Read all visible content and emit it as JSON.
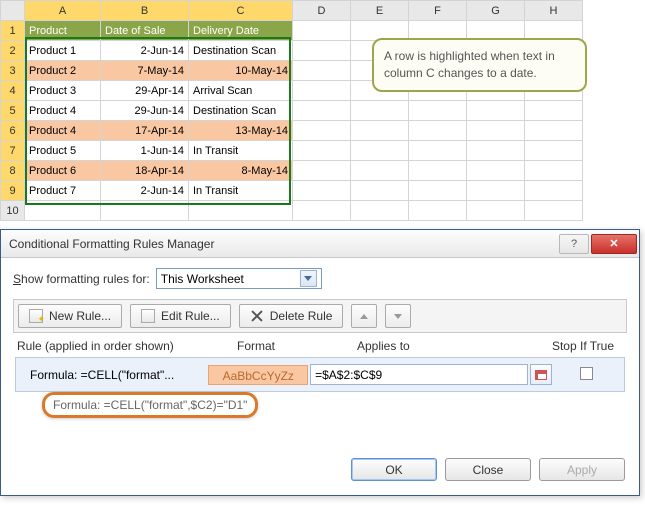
{
  "sheet": {
    "columns": [
      "A",
      "B",
      "C",
      "D",
      "E",
      "F",
      "G",
      "H"
    ],
    "rownums": [
      "1",
      "2",
      "3",
      "4",
      "5",
      "6",
      "7",
      "8",
      "9",
      "10"
    ],
    "header": {
      "a": "Product",
      "b": "Date of Sale",
      "c": "Delivery Date"
    },
    "rows": [
      {
        "a": "Product 1",
        "b": "2-Jun-14",
        "c": "Destination Scan",
        "hl": false
      },
      {
        "a": "Product 2",
        "b": "7-May-14",
        "c": "10-May-14",
        "hl": true
      },
      {
        "a": "Product 3",
        "b": "29-Apr-14",
        "c": "Arrival Scan",
        "hl": false
      },
      {
        "a": "Product 4",
        "b": "29-Jun-14",
        "c": "Destination Scan",
        "hl": false
      },
      {
        "a": "Product 4",
        "b": "17-Apr-14",
        "c": "13-May-14",
        "hl": true
      },
      {
        "a": "Product 5",
        "b": "1-Jun-14",
        "c": "In Transit",
        "hl": false
      },
      {
        "a": "Product 6",
        "b": "18-Apr-14",
        "c": "8-May-14",
        "hl": true
      },
      {
        "a": "Product 7",
        "b": "2-Jun-14",
        "c": "In Transit",
        "hl": false
      }
    ]
  },
  "callout": "A row is highlighted when text in column C changes to a date.",
  "dialog": {
    "title": "Conditional Formatting Rules Manager",
    "show_label_pre": "S",
    "show_label_post": "how formatting rules for:",
    "scope": "This Worksheet",
    "toolbar": {
      "new": "New Rule...",
      "edit": "Edit Rule...",
      "delete": "Delete Rule"
    },
    "columns": {
      "rule": "Rule (applied in order shown)",
      "format": "Format",
      "applies": "Applies to",
      "stop": "Stop If True"
    },
    "rule": {
      "text": "Formula: =CELL(\"format\"...",
      "preview": "AaBbCcYyZz",
      "applies_to": "=$A$2:$C$9"
    },
    "tooltip": "Formula: =CELL(\"format\",$C2)=\"D1\"",
    "buttons": {
      "ok": "OK",
      "close": "Close",
      "apply": "Apply"
    }
  }
}
